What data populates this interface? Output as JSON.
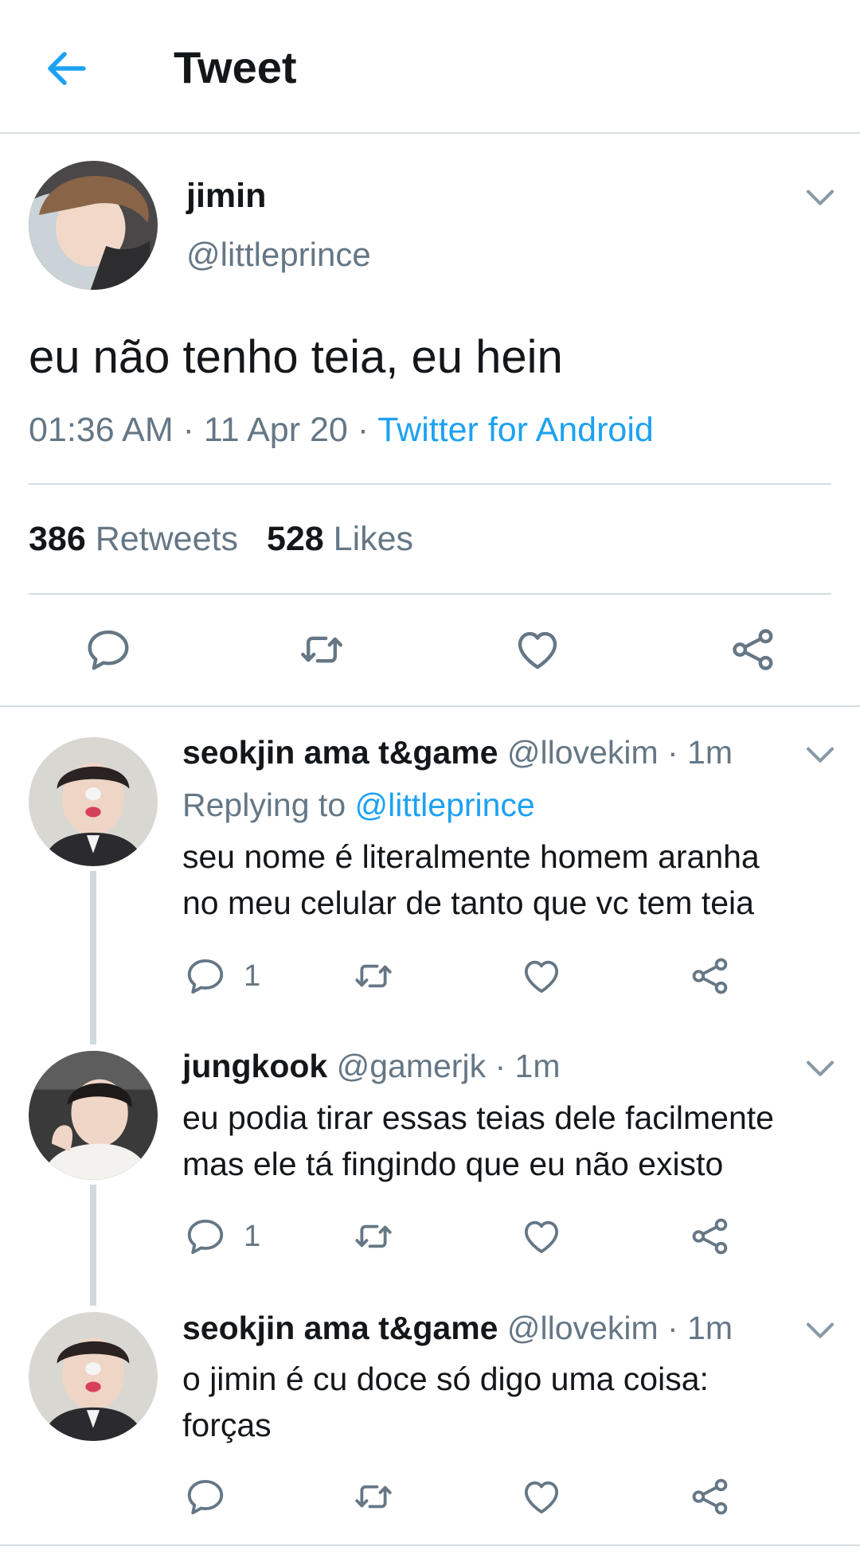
{
  "header": {
    "title": "Tweet",
    "back_icon": "arrow-left-icon",
    "accent": "#1da1f2"
  },
  "tweet": {
    "name": "jimin",
    "handle": "@littleprince",
    "text": "eu não tenho teia, eu hein",
    "time": "01:36 AM",
    "date": "11 Apr 20",
    "source": "Twitter for Android",
    "retweets_count": "386",
    "retweets_label": "Retweets",
    "likes_count": "528",
    "likes_label": "Likes"
  },
  "replies": [
    {
      "name": "seokjin ama t&game",
      "handle": "@llovekim",
      "time": "1m",
      "replying_label": "Replying to",
      "replying_to": "@littleprince",
      "lines": [
        "seu nome é literalmente homem aranha",
        "no meu celular de tanto que vc tem teia"
      ],
      "reply_count": "1"
    },
    {
      "name": "jungkook",
      "handle": "@gamerjk",
      "time": "1m",
      "lines": [
        "eu podia tirar essas teias dele facilmente",
        "mas ele tá fingindo que eu não existo"
      ],
      "reply_count": "1"
    },
    {
      "name": "seokjin ama t&game",
      "handle": "@llovekim",
      "time": "1m",
      "lines": [
        "o jimin é cu doce só digo uma coisa:",
        "forças"
      ],
      "reply_count": ""
    }
  ],
  "separator": " · "
}
